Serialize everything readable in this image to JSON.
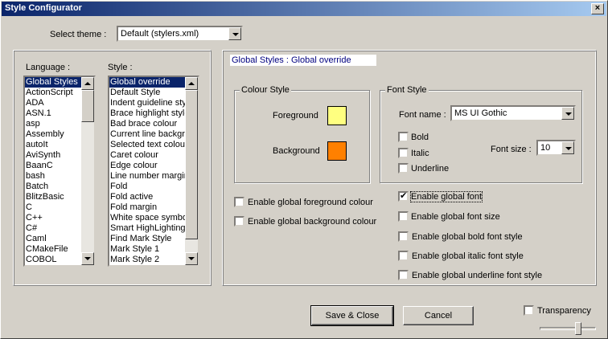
{
  "window": {
    "title": "Style Configurator",
    "close_glyph": "×"
  },
  "theme": {
    "label": "Select theme :",
    "value": "Default (stylers.xml)"
  },
  "language": {
    "label": "Language :",
    "items": [
      "Global Styles",
      "ActionScript",
      "ADA",
      "ASN.1",
      "asp",
      "Assembly",
      "autoIt",
      "AviSynth",
      "BaanC",
      "bash",
      "Batch",
      "BlitzBasic",
      "C",
      "C++",
      "C#",
      "Caml",
      "CMakeFile",
      "COBOL"
    ]
  },
  "style": {
    "label": "Style :",
    "items": [
      "Global override",
      "Default Style",
      "Indent guideline sty",
      "Brace highlight style",
      "Bad brace colour",
      "Current line backgro",
      "Selected text colour",
      "Caret colour",
      "Edge colour",
      "Line number margin",
      "Fold",
      "Fold active",
      "Fold margin",
      "White space symbo",
      "Smart HighLighting",
      "Find Mark Style",
      "Mark Style 1",
      "Mark Style 2"
    ]
  },
  "header": {
    "text": "Global Styles : Global override"
  },
  "colour_style": {
    "title": "Colour Style",
    "foreground_label": "Foreground",
    "background_label": "Background",
    "foreground_color": "#ffff80",
    "background_color": "#ff8000"
  },
  "font_style": {
    "title": "Font Style",
    "font_name_label": "Font name :",
    "font_name_value": "MS UI Gothic",
    "font_size_label": "Font size :",
    "font_size_value": "10",
    "bold_label": "Bold",
    "italic_label": "Italic",
    "underline_label": "Underline"
  },
  "enables": {
    "fg": "Enable global foreground colour",
    "bg": "Enable global background colour",
    "font": "Enable global font",
    "font_size": "Enable global font size",
    "bold": "Enable global bold font style",
    "italic": "Enable global italic font style",
    "underline": "Enable global underline font style"
  },
  "buttons": {
    "save": "Save & Close",
    "cancel": "Cancel"
  },
  "transparency": {
    "label": "Transparency"
  }
}
